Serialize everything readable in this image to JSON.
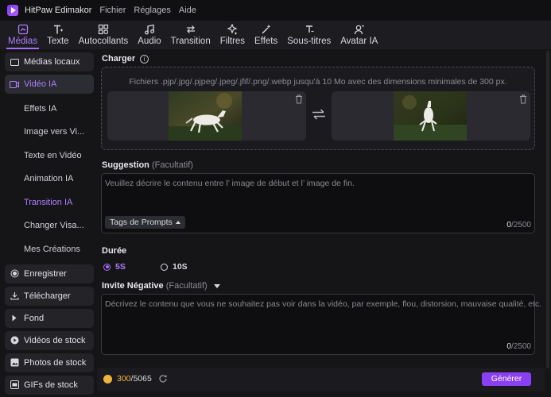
{
  "app": {
    "title": "HitPaw Edimakor",
    "menu": [
      "Fichier",
      "Réglages",
      "Aide"
    ]
  },
  "toolbar": {
    "tabs": [
      {
        "label": "Médias",
        "icon": "media-icon",
        "active": true
      },
      {
        "label": "Texte",
        "icon": "text-icon"
      },
      {
        "label": "Autocollants",
        "icon": "sticker-icon"
      },
      {
        "label": "Audio",
        "icon": "audio-icon"
      },
      {
        "label": "Transition",
        "icon": "transition-icon"
      },
      {
        "label": "Filtres",
        "icon": "filter-icon"
      },
      {
        "label": "Effets",
        "icon": "effects-icon"
      },
      {
        "label": "Sous-titres",
        "icon": "subtitles-icon"
      },
      {
        "label": "Avatar IA",
        "icon": "avatar-icon"
      }
    ]
  },
  "sidebar": {
    "local_media": "Médias locaux",
    "video_ia": "Vidéo IA",
    "sub_items": [
      "Effets IA",
      "Image vers Vi...",
      "Texte en Vidéo",
      "Animation IA",
      "Transition IA",
      "Changer Visa...",
      "Mes Créations"
    ],
    "active_sub": "Transition IA",
    "groups": [
      "Enregistrer",
      "Télécharger",
      "Fond",
      "Vidéos de stock",
      "Photos de stock",
      "GIFs de stock"
    ]
  },
  "upload": {
    "label": "Charger",
    "hint": "Fichiers .pjp/.jpg/.pjpeg/.jpeg/.jfif/.png/.webp jusqu'à 10 Mo avec des dimensions minimales de 300 px."
  },
  "suggestion": {
    "label": "Suggestion",
    "optional": "(Facultatif)",
    "placeholder": "Veuillez décrire le contenu entre l’ image de début et l’ image de fin.",
    "tags_button": "Tags de Prompts",
    "count": "0",
    "max": "/2500"
  },
  "duration": {
    "label": "Durée",
    "options": [
      "5S",
      "10S"
    ],
    "selected": "5S"
  },
  "negative": {
    "label": "Invite Négative",
    "optional": "(Facultatif)",
    "placeholder": "Décrivez le contenu que vous ne souhaitez pas voir dans la vidéo, par exemple, flou, distorsion, mauvaise qualité, etc.",
    "count": "0",
    "max": "/2500"
  },
  "footer": {
    "credits_used": "300",
    "credits_total": "/5065",
    "generate": "Générer"
  },
  "colors": {
    "accent": "#a86cff",
    "generate_button": "#8a3ff2",
    "coin": "#f0b43c"
  }
}
